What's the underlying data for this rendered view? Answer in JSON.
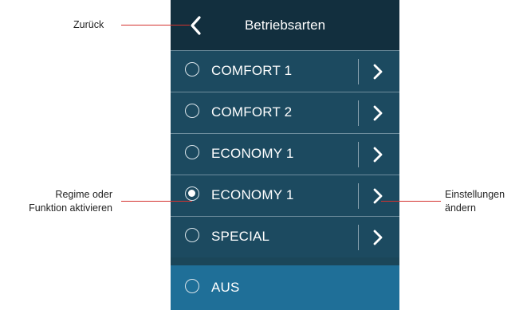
{
  "header": {
    "title": "Betriebsarten",
    "back_icon": "chevron-left-icon"
  },
  "modes": [
    {
      "label": "COMFORT 1",
      "selected": false,
      "has_settings": true
    },
    {
      "label": "COMFORT 2",
      "selected": false,
      "has_settings": true
    },
    {
      "label": "ECONOMY 1",
      "selected": false,
      "has_settings": true
    },
    {
      "label": "ECONOMY 1",
      "selected": true,
      "has_settings": true
    },
    {
      "label": "SPECIAL",
      "selected": false,
      "has_settings": true
    },
    {
      "label": "AUS",
      "selected": false,
      "has_settings": false
    }
  ],
  "annotations": {
    "back": "Zurück",
    "activate_line1": "Regime oder",
    "activate_line2": "Funktion aktivieren",
    "settings_line1": "Einstellungen",
    "settings_line2": "ändern"
  },
  "colors": {
    "header_bg": "#122f3e",
    "row_bg": "#1c4a60",
    "last_row_bg": "#1f6f98",
    "annotation_line": "#d4322f"
  }
}
